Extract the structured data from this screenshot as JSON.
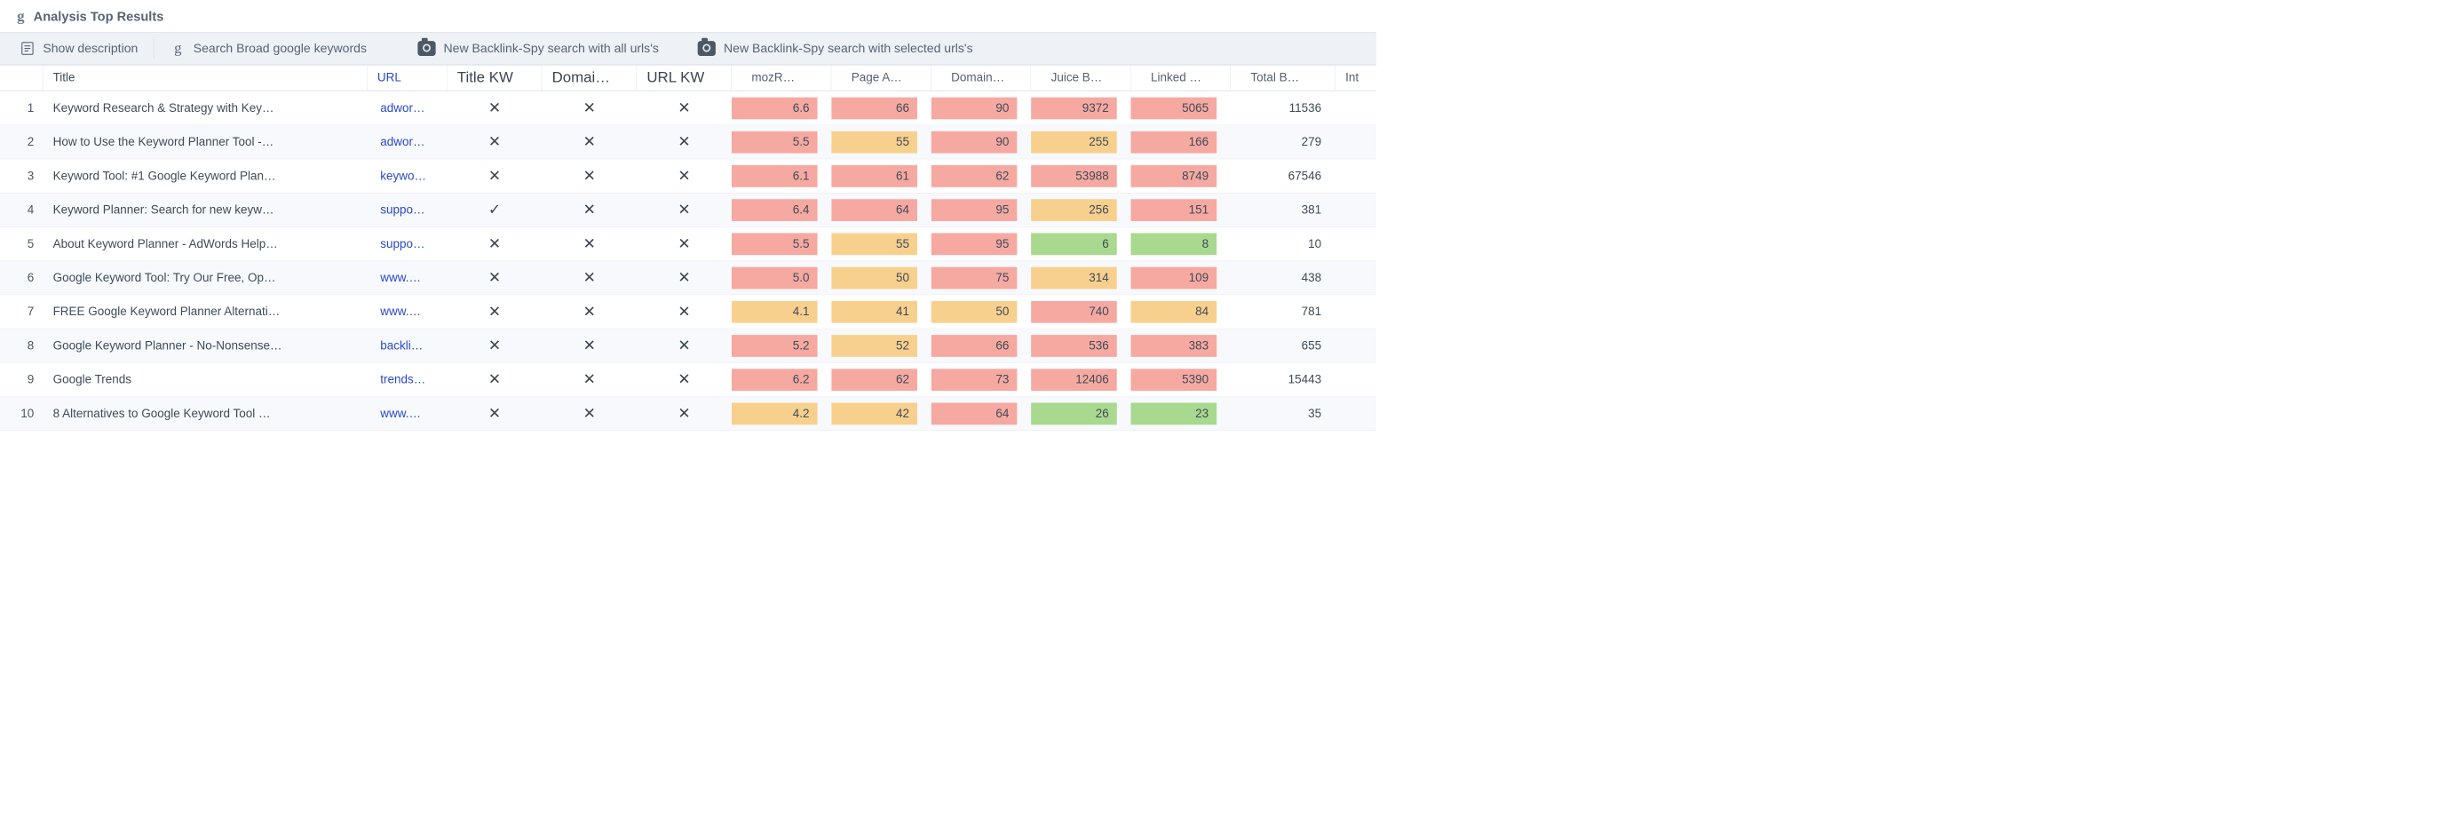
{
  "panel_title": "Analysis Top Results",
  "toolbar": {
    "show_desc": "Show description",
    "search_broad": "Search Broad google keywords",
    "bls_all": "New Backlink-Spy search with all urls's",
    "bls_sel": "New Backlink-Spy search with selected urls's"
  },
  "columns": {
    "idx": "",
    "title": "Title",
    "url": "URL",
    "title_kw": "Title KW",
    "domain_kw": "Domai…",
    "url_kw": "URL KW",
    "mozrank": "mozR…",
    "page_auth": "Page A…",
    "domain_auth": "Domain…",
    "juice": "Juice B…",
    "linked": "Linked …",
    "total": "Total B…",
    "int": "Int"
  },
  "rows": [
    {
      "idx": "1",
      "title": "Keyword Research & Strategy with Key…",
      "url": "adwor…",
      "tkw": "x",
      "dkw": "x",
      "ukw": "x",
      "moz": {
        "v": "6.6",
        "h": "r"
      },
      "pa": {
        "v": "66",
        "h": "r"
      },
      "da": {
        "v": "90",
        "h": "r"
      },
      "jb": {
        "v": "9372",
        "h": "r"
      },
      "lk": {
        "v": "5065",
        "h": "r"
      },
      "tot": "11536"
    },
    {
      "idx": "2",
      "title": "How to Use the Keyword Planner Tool -…",
      "url": "adwor…",
      "tkw": "x",
      "dkw": "x",
      "ukw": "x",
      "moz": {
        "v": "5.5",
        "h": "r"
      },
      "pa": {
        "v": "55",
        "h": "o"
      },
      "da": {
        "v": "90",
        "h": "r"
      },
      "jb": {
        "v": "255",
        "h": "o"
      },
      "lk": {
        "v": "166",
        "h": "r"
      },
      "tot": "279"
    },
    {
      "idx": "3",
      "title": "Keyword Tool: #1 Google Keyword Plan…",
      "url": "keywo…",
      "tkw": "x",
      "dkw": "x",
      "ukw": "x",
      "moz": {
        "v": "6.1",
        "h": "r"
      },
      "pa": {
        "v": "61",
        "h": "r"
      },
      "da": {
        "v": "62",
        "h": "r"
      },
      "jb": {
        "v": "53988",
        "h": "r"
      },
      "lk": {
        "v": "8749",
        "h": "r"
      },
      "tot": "67546"
    },
    {
      "idx": "4",
      "title": "Keyword Planner: Search for new keyw…",
      "url": "suppo…",
      "tkw": "c",
      "dkw": "x",
      "ukw": "x",
      "moz": {
        "v": "6.4",
        "h": "r"
      },
      "pa": {
        "v": "64",
        "h": "r"
      },
      "da": {
        "v": "95",
        "h": "r"
      },
      "jb": {
        "v": "256",
        "h": "o"
      },
      "lk": {
        "v": "151",
        "h": "r"
      },
      "tot": "381"
    },
    {
      "idx": "5",
      "title": "About Keyword Planner - AdWords Help…",
      "url": "suppo…",
      "tkw": "x",
      "dkw": "x",
      "ukw": "x",
      "moz": {
        "v": "5.5",
        "h": "r"
      },
      "pa": {
        "v": "55",
        "h": "o"
      },
      "da": {
        "v": "95",
        "h": "r"
      },
      "jb": {
        "v": "6",
        "h": "g"
      },
      "lk": {
        "v": "8",
        "h": "g"
      },
      "tot": "10"
    },
    {
      "idx": "6",
      "title": "Google Keyword Tool: Try Our Free, Op…",
      "url": "www.…",
      "tkw": "x",
      "dkw": "x",
      "ukw": "x",
      "moz": {
        "v": "5.0",
        "h": "r"
      },
      "pa": {
        "v": "50",
        "h": "o"
      },
      "da": {
        "v": "75",
        "h": "r"
      },
      "jb": {
        "v": "314",
        "h": "o"
      },
      "lk": {
        "v": "109",
        "h": "r"
      },
      "tot": "438"
    },
    {
      "idx": "7",
      "title": "FREE Google Keyword Planner Alternati…",
      "url": "www.…",
      "tkw": "x",
      "dkw": "x",
      "ukw": "x",
      "moz": {
        "v": "4.1",
        "h": "o"
      },
      "pa": {
        "v": "41",
        "h": "o"
      },
      "da": {
        "v": "50",
        "h": "o"
      },
      "jb": {
        "v": "740",
        "h": "r"
      },
      "lk": {
        "v": "84",
        "h": "o"
      },
      "tot": "781"
    },
    {
      "idx": "8",
      "title": "Google Keyword Planner - No-Nonsense…",
      "url": "backli…",
      "tkw": "x",
      "dkw": "x",
      "ukw": "x",
      "moz": {
        "v": "5.2",
        "h": "r"
      },
      "pa": {
        "v": "52",
        "h": "o"
      },
      "da": {
        "v": "66",
        "h": "r"
      },
      "jb": {
        "v": "536",
        "h": "r"
      },
      "lk": {
        "v": "383",
        "h": "r"
      },
      "tot": "655"
    },
    {
      "idx": "9",
      "title": "Google Trends",
      "url": "trends…",
      "tkw": "x",
      "dkw": "x",
      "ukw": "x",
      "moz": {
        "v": "6.2",
        "h": "r"
      },
      "pa": {
        "v": "62",
        "h": "r"
      },
      "da": {
        "v": "73",
        "h": "r"
      },
      "jb": {
        "v": "12406",
        "h": "r"
      },
      "lk": {
        "v": "5390",
        "h": "r"
      },
      "tot": "15443"
    },
    {
      "idx": "10",
      "title": "8 Alternatives to Google Keyword Tool …",
      "url": "www.…",
      "tkw": "x",
      "dkw": "x",
      "ukw": "x",
      "moz": {
        "v": "4.2",
        "h": "o"
      },
      "pa": {
        "v": "42",
        "h": "o"
      },
      "da": {
        "v": "64",
        "h": "r"
      },
      "jb": {
        "v": "26",
        "h": "g"
      },
      "lk": {
        "v": "23",
        "h": "g"
      },
      "tot": "35"
    }
  ],
  "glyphs": {
    "x": "✕",
    "c": "✓"
  }
}
